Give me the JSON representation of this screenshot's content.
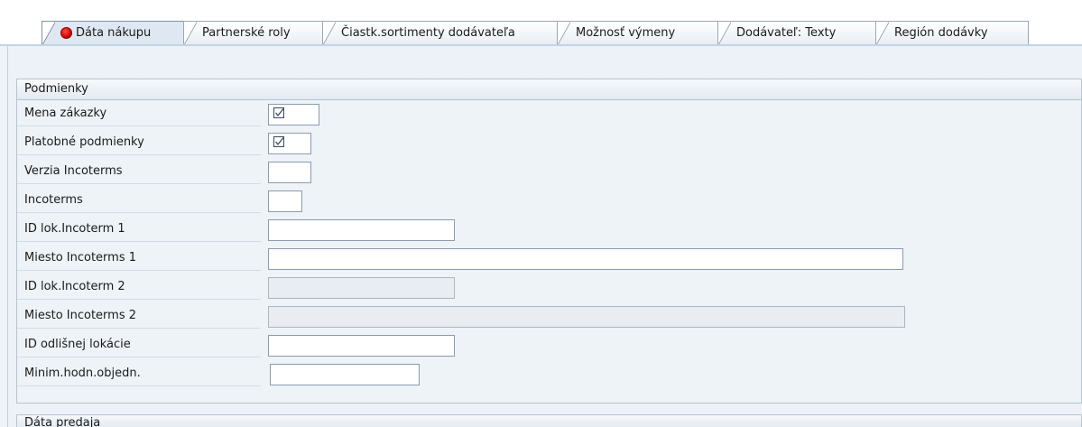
{
  "tabs": [
    {
      "label": "Dáta nákupu",
      "active": true,
      "status_icon": "red-status-icon"
    },
    {
      "label": "Partnerské roly",
      "active": false
    },
    {
      "label": "Čiastk.sortimenty dodávateľa",
      "active": false
    },
    {
      "label": "Možnosť výmeny",
      "active": false
    },
    {
      "label": "Dodávateľ: Texty",
      "active": false
    },
    {
      "label": "Región dodávky",
      "active": false
    }
  ],
  "conditions": {
    "title": "Podmienky",
    "fields": [
      {
        "label": "Mena zákazky",
        "value": "",
        "type": "checkbox-marker",
        "editable": true
      },
      {
        "label": "Platobné podmienky",
        "value": "",
        "type": "checkbox-marker",
        "editable": true
      },
      {
        "label": "Verzia Incoterms",
        "value": "",
        "type": "input",
        "editable": true
      },
      {
        "label": "Incoterms",
        "value": "",
        "type": "input",
        "editable": true
      },
      {
        "label": "ID lok.Incoterm 1",
        "value": "",
        "type": "input",
        "editable": true
      },
      {
        "label": "Miesto Incoterms 1",
        "value": "",
        "type": "input",
        "editable": true
      },
      {
        "label": "ID lok.Incoterm 2",
        "value": "",
        "type": "input",
        "editable": false
      },
      {
        "label": "Miesto Incoterms 2",
        "value": "",
        "type": "input",
        "editable": false
      },
      {
        "label": "ID odlišnej lokácie",
        "value": "",
        "type": "input",
        "editable": true
      },
      {
        "label": "Minim.hodn.objedn.",
        "value": "",
        "type": "input",
        "editable": true
      }
    ]
  },
  "sales_group": {
    "title": "Dáta predaja"
  },
  "colors": {
    "accent": "#c40000",
    "panel_bg": "#eef3f8",
    "border": "#8a9bae"
  }
}
